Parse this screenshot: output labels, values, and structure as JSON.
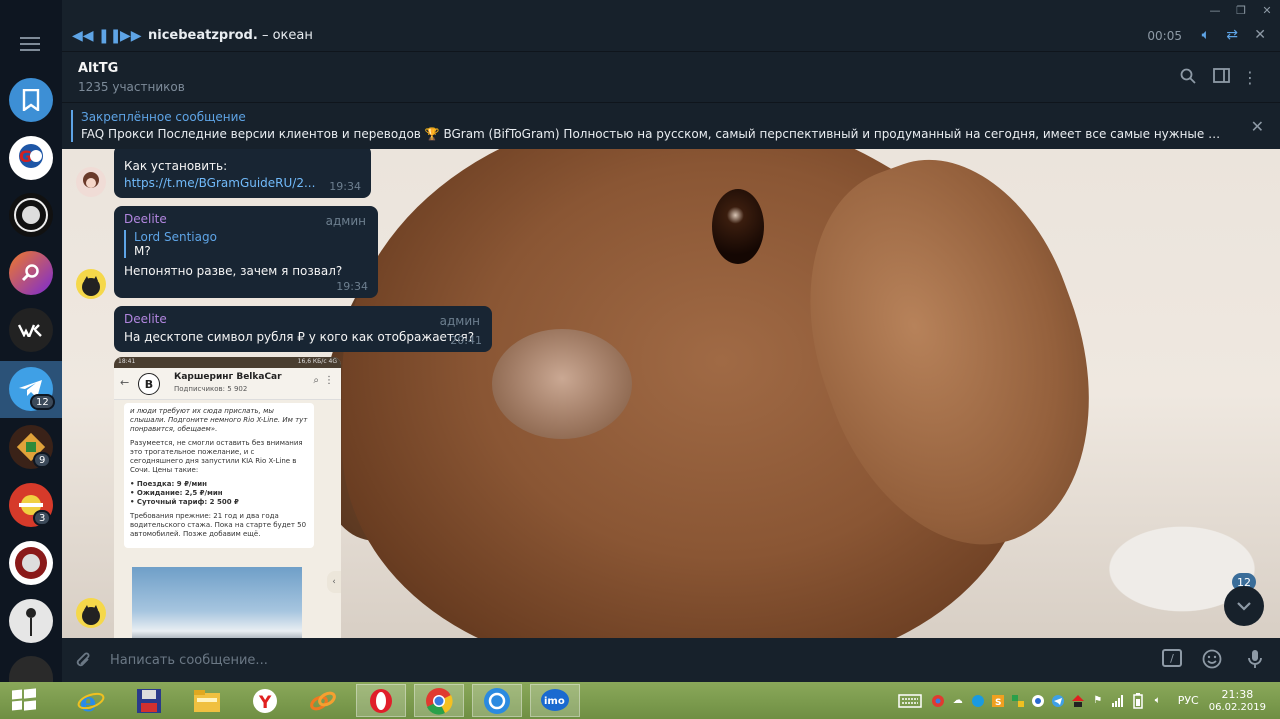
{
  "player": {
    "track_artist": "nicebeatzprod.",
    "track_title": " – океан",
    "time": "00:05"
  },
  "header": {
    "title": "AltTG",
    "subtitle": "1235 участников"
  },
  "pinned": {
    "label": "Закреплённое сообщение",
    "text": "FAQ  Прокси   Последние версии клиентов и переводов 🏆 BGram (BifToGram)  Полностью на русском, самый перспективный и продуманный на сегодня, имеет все самые нужные функции от в..."
  },
  "sidebar": {
    "badges": [
      "12",
      "9",
      "3"
    ]
  },
  "messages": [
    {
      "text": "Как установить:",
      "link": "https://t.me/BGramGuideRU/2...",
      "time": "19:34"
    },
    {
      "name": "Deelite",
      "role": "админ",
      "reply_name": "Lord Sentiago",
      "reply_text": "М?",
      "text": "Непонятно разве, зачем я позвал?",
      "time": "19:34"
    },
    {
      "name": "Deelite",
      "role": "админ",
      "text": "На десктопе символ рубля ₽ у кого как отображается?",
      "time": "20:41"
    }
  ],
  "screenshot": {
    "status_time": "18:41",
    "status_right": "16,6 КБ/с  4G",
    "logo": "B",
    "title": "Каршеринг BelkaCar",
    "subscribers": "Подписчиков: 5 902",
    "p1": "и люди требуют их сюда прислать, мы слышали. Подгоните немного Rio X-Line. Им тут понравится, обещаем».",
    "p2": "Разумеется, не смогли оставить без внимания это трогательное пожелание, и с сегодняшнего дня запустили KIA Rio X-Line в Сочи. Цены такие:",
    "p3a": "• Поездка: 9 ₽/мин",
    "p3b": "• Ожидание: 2,5 ₽/мин",
    "p3c": "• Суточный тариф: 2 500 ₽",
    "p4": "Требования прежние: 21 год и два года водительского стажа. Пока на старте будет 50 автомобилей. Позже добавим ещё."
  },
  "scroll_badge": "12",
  "composer": {
    "placeholder": "Написать сообщение..."
  },
  "taskbar": {
    "lang": "РУС",
    "time": "21:38",
    "date": "06.02.2019"
  },
  "colors": {
    "accent": "#5ea4e6",
    "name": "#b286e0",
    "bubble": "#182533",
    "panel": "#17212b",
    "active": "#2b5278"
  }
}
